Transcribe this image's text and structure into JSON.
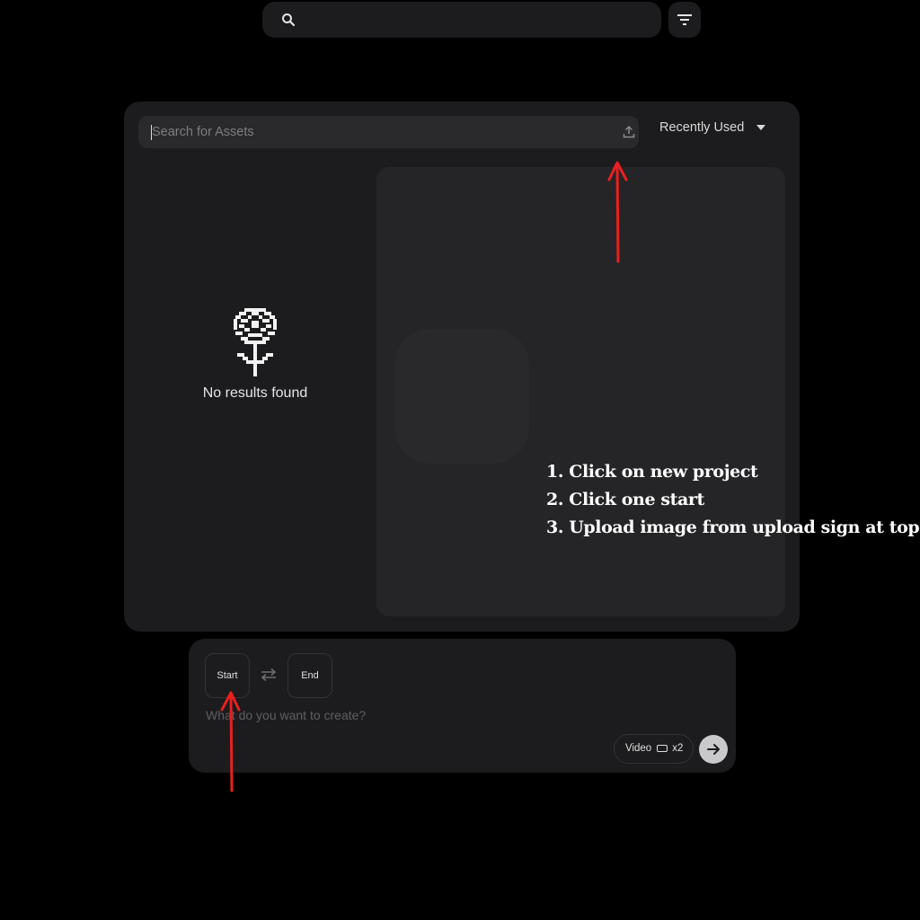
{
  "top_bar": {
    "search_icon": "search-icon",
    "filter_icon": "filter-icon"
  },
  "asset_panel": {
    "search_placeholder": "Search for Assets",
    "upload_icon": "upload-icon",
    "sort_label": "Recently Used",
    "empty_state_text": "No results found",
    "empty_state_icon": "pixel-flower-icon"
  },
  "annotation": {
    "steps": [
      "1. Click on new project",
      "2. Click one start",
      "3. Upload image from upload sign at top"
    ],
    "arrow_color": "#e8201f"
  },
  "composer": {
    "start_label": "Start",
    "end_label": "End",
    "swap_icon": "swap-icon",
    "prompt_placeholder": "What do you want to create?",
    "mode_label": "Video",
    "count_label": "x2",
    "submit_icon": "arrow-right-icon"
  }
}
